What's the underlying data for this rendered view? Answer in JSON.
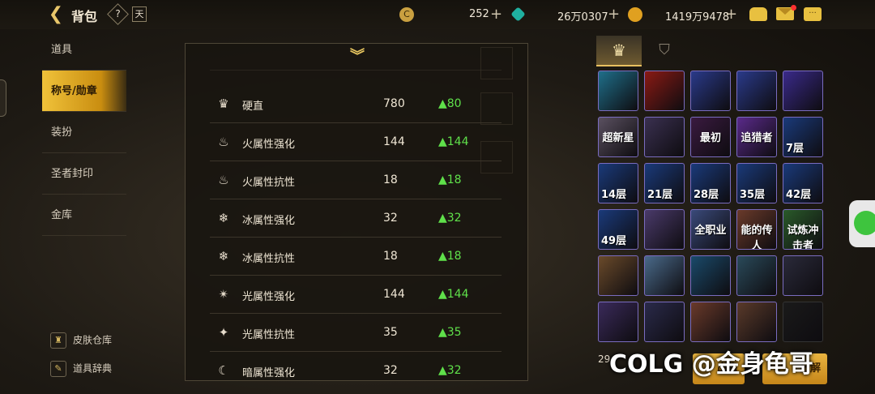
{
  "header": {
    "title": "背包",
    "help_label": "?",
    "calendar_label": "天",
    "currencies": [
      {
        "icon": "coin-c-icon",
        "value": "252"
      },
      {
        "icon": "gem-icon",
        "value": "26万0307"
      },
      {
        "icon": "gold-coin-icon",
        "value": "1419万9478"
      }
    ],
    "plus": "+"
  },
  "sidebar": {
    "items": [
      {
        "label": "道具",
        "active": false
      },
      {
        "label": "称号/勋章",
        "active": true
      },
      {
        "label": "装扮",
        "active": false
      },
      {
        "label": "圣者封印",
        "active": false
      },
      {
        "label": "金库",
        "active": false
      }
    ],
    "bottom": [
      {
        "label": "皮肤仓库",
        "icon": "skin-wardrobe-icon"
      },
      {
        "label": "道具辞典",
        "icon": "item-dictionary-icon"
      }
    ]
  },
  "stats": {
    "rows": [
      {
        "name": "硬直",
        "value": "780",
        "bonus": "▲80",
        "icon": "stagger-icon"
      },
      {
        "name": "火属性强化",
        "value": "144",
        "bonus": "▲144",
        "icon": "fire-enhance-icon"
      },
      {
        "name": "火属性抗性",
        "value": "18",
        "bonus": "▲18",
        "icon": "fire-resist-icon"
      },
      {
        "name": "冰属性强化",
        "value": "32",
        "bonus": "▲32",
        "icon": "ice-enhance-icon"
      },
      {
        "name": "冰属性抗性",
        "value": "18",
        "bonus": "▲18",
        "icon": "ice-resist-icon"
      },
      {
        "name": "光属性强化",
        "value": "144",
        "bonus": "▲144",
        "icon": "light-enhance-icon"
      },
      {
        "name": "光属性抗性",
        "value": "35",
        "bonus": "▲35",
        "icon": "light-resist-icon"
      },
      {
        "name": "暗属性强化",
        "value": "32",
        "bonus": "▲32",
        "icon": "dark-enhance-icon"
      }
    ]
  },
  "collection": {
    "tabs": [
      {
        "icon": "crown-medal-icon"
      },
      {
        "icon": "badge-icon"
      }
    ],
    "cells": [
      {
        "label": "",
        "bg": "#1f6f8a",
        "name": "cyan-bird-title"
      },
      {
        "label": "",
        "bg": "#8a1a14",
        "name": "red-figure-title"
      },
      {
        "label": "",
        "bg": "#2a3a8a",
        "name": "gold-medal-1"
      },
      {
        "label": "",
        "bg": "#2a3a8a",
        "name": "gold-medal-2"
      },
      {
        "label": "",
        "bg": "#3a2a8a",
        "name": "green-medal"
      },
      {
        "label": "超新星",
        "bg": "#5a5060",
        "name": "supernova-title"
      },
      {
        "label": "",
        "bg": "#3a3050",
        "name": "girl-portrait"
      },
      {
        "label": "最初",
        "bg": "#3a1a40",
        "name": "first-title"
      },
      {
        "label": "追猎者",
        "bg": "#5a2a8a",
        "name": "hunter-title"
      },
      {
        "label": "7层",
        "bg": "#1a3a7a",
        "name": "floor-7"
      },
      {
        "label": "14层",
        "bg": "#1a3a7a",
        "name": "floor-14"
      },
      {
        "label": "21层",
        "bg": "#1a3a7a",
        "name": "floor-21"
      },
      {
        "label": "28层",
        "bg": "#1a3a7a",
        "name": "floor-28"
      },
      {
        "label": "35层",
        "bg": "#1a3a7a",
        "name": "floor-35"
      },
      {
        "label": "42层",
        "bg": "#1a3a7a",
        "name": "floor-42"
      },
      {
        "label": "49层",
        "bg": "#1a3a7a",
        "name": "floor-49"
      },
      {
        "label": "",
        "bg": "#4a3a6a",
        "name": "dark-creature"
      },
      {
        "label": "全职业",
        "bg": "#3a4a7a",
        "name": "all-class-title"
      },
      {
        "label": "能的传人",
        "bg": "#6a3a2a",
        "name": "heir-title"
      },
      {
        "label": "试炼冲击者",
        "bg": "#2a5a2a",
        "name": "trial-title"
      },
      {
        "label": "",
        "bg": "#6a4a2a",
        "name": "golden-wing"
      },
      {
        "label": "",
        "bg": "#4a6a8a",
        "name": "tower"
      },
      {
        "label": "",
        "bg": "#1a4a6a",
        "name": "gold-medal-round"
      },
      {
        "label": "",
        "bg": "#2a4a5a",
        "name": "ship"
      },
      {
        "label": "",
        "bg": "#2a2a3a",
        "name": "gate"
      },
      {
        "label": "",
        "bg": "#3a2a5a",
        "name": "purple-beast"
      },
      {
        "label": "",
        "bg": "#2a2a4a",
        "name": "mech-beast"
      },
      {
        "label": "",
        "bg": "#6a3a2a",
        "name": "girl-red"
      },
      {
        "label": "",
        "bg": "#5a3a2a",
        "name": "girl-flower"
      },
      {
        "label": "",
        "bg": "#1a1a1a",
        "name": "empty-slot"
      }
    ],
    "count_text": "29",
    "btn_sell": "出售",
    "btn_split": "分解"
  },
  "watermark": "COLG @金身龟哥",
  "colors": {
    "accent": "#e8c060",
    "bonus": "#5fe04a"
  }
}
